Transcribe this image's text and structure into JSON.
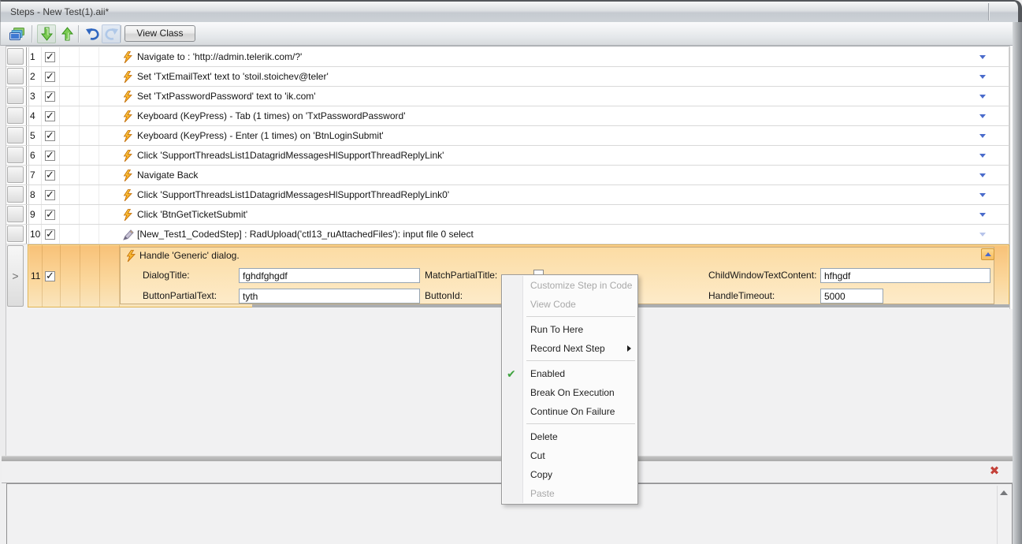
{
  "window": {
    "title": "Steps - New Test(1).aii*"
  },
  "toolbar": {
    "buttons": [
      {
        "name": "organize-windows",
        "icon": "layers-icon"
      },
      {
        "name": "move-step-down",
        "icon": "green-arrow-down-icon"
      },
      {
        "name": "move-step-up",
        "icon": "green-arrow-up-icon"
      },
      {
        "name": "undo",
        "icon": "undo-icon"
      },
      {
        "name": "redo",
        "icon": "redo-icon",
        "disabled": true
      }
    ],
    "view_class_label": "View Class"
  },
  "steps": [
    {
      "num": "1",
      "checked": true,
      "icon": "lightning",
      "text": "Navigate to : 'http://admin.telerik.com/?'"
    },
    {
      "num": "2",
      "checked": true,
      "icon": "lightning",
      "text": "Set 'TxtEmailText' text to 'stoil.stoichev@teler'"
    },
    {
      "num": "3",
      "checked": true,
      "icon": "lightning",
      "text": "Set 'TxtPasswordPassword' text to 'ik.com'"
    },
    {
      "num": "4",
      "checked": true,
      "icon": "lightning",
      "text": "Keyboard (KeyPress) - Tab (1 times) on 'TxtPasswordPassword'"
    },
    {
      "num": "5",
      "checked": true,
      "icon": "lightning",
      "text": "Keyboard (KeyPress) - Enter (1 times) on 'BtnLoginSubmit'"
    },
    {
      "num": "6",
      "checked": true,
      "icon": "lightning",
      "text": "Click 'SupportThreadsList1DatagridMessagesHlSupportThreadReplyLink'"
    },
    {
      "num": "7",
      "checked": true,
      "icon": "lightning",
      "text": "Navigate Back"
    },
    {
      "num": "8",
      "checked": true,
      "icon": "lightning",
      "text": "Click 'SupportThreadsList1DatagridMessagesHlSupportThreadReplyLink0'"
    },
    {
      "num": "9",
      "checked": true,
      "icon": "lightning",
      "text": "Click 'BtnGetTicketSubmit'"
    },
    {
      "num": "10",
      "checked": true,
      "icon": "coded-step-pencil",
      "text": "[New_Test1_CodedStep] : RadUpload('ctl13_ruAttachedFiles'): input file 0 select"
    }
  ],
  "expanded_step": {
    "num": "11",
    "checked": true,
    "title": "Handle 'Generic' dialog.",
    "fields": {
      "dialog_title": {
        "label": "DialogTitle:",
        "value": "fghdfghgdf"
      },
      "match_partial_title": {
        "label": "MatchPartialTitle:",
        "checked": false
      },
      "child_window_text_content": {
        "label": "ChildWindowTextContent:",
        "value": "hfhgdf"
      },
      "button_partial_text": {
        "label": "ButtonPartialText:",
        "value": "tyth"
      },
      "button_id": {
        "label": "ButtonId:"
      },
      "handle_timeout": {
        "label": "HandleTimeout:",
        "value": "5000"
      }
    }
  },
  "context_menu": {
    "items": [
      {
        "label": "Customize Step in Code",
        "disabled": true
      },
      {
        "label": "View Code",
        "disabled": true
      },
      {
        "type": "separator"
      },
      {
        "label": "Run To Here"
      },
      {
        "label": "Record Next Step",
        "submenu": true
      },
      {
        "type": "separator"
      },
      {
        "label": "Enabled",
        "checked": true
      },
      {
        "label": "Break On Execution"
      },
      {
        "label": "Continue On Failure"
      },
      {
        "type": "separator"
      },
      {
        "label": "Delete"
      },
      {
        "label": "Cut"
      },
      {
        "label": "Copy"
      },
      {
        "label": "Paste",
        "disabled": true
      }
    ]
  },
  "colors": {
    "selected_row_top": "#F8C177",
    "selected_row_bottom": "#F9E5BE",
    "selection_border": "#DFB256",
    "menu_check_green": "#3FA33F",
    "dropdown_arrow_blue": "#4A6BCB",
    "close_red": "#C4423A"
  }
}
